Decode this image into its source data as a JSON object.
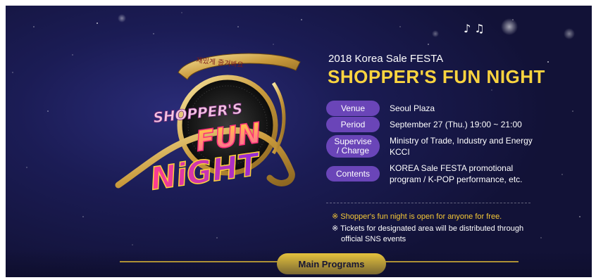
{
  "logo": {
    "ribbon_text": "재밌게 즐겨봐요",
    "word1": "SHOPPER'S",
    "word2": "FUN",
    "word3": "NiGHT"
  },
  "header": {
    "music_glyph": "♪ ♫",
    "kicker": "2018 Korea Sale FESTA",
    "title": "SHOPPER'S FUN NIGHT"
  },
  "info": {
    "rows": [
      {
        "label": "Venue",
        "value": "Seoul Plaza"
      },
      {
        "label": "Period",
        "value": "September 27 (Thu.) 19:00 ~ 21:00"
      },
      {
        "label_line1": "Supervise",
        "label_line2": "/ Charge",
        "value_line1": "Ministry of Trade, Industry and Energy",
        "value_line2": "KCCI"
      },
      {
        "label": "Contents",
        "value_line1": "KOREA Sale FESTA promotional",
        "value_line2": "program / K-POP performance, etc."
      }
    ]
  },
  "notes": {
    "note1": "※ Shopper's fun night is open for anyone for free.",
    "note2_line1": "※ Tickets for designated area will be distributed through",
    "note2_line2": "official SNS events"
  },
  "programs": {
    "label": "Main Programs"
  },
  "colors": {
    "accent_yellow": "#fbd43f",
    "badge_purple": "#6a45b8",
    "background_navy": "#1b1c55"
  }
}
